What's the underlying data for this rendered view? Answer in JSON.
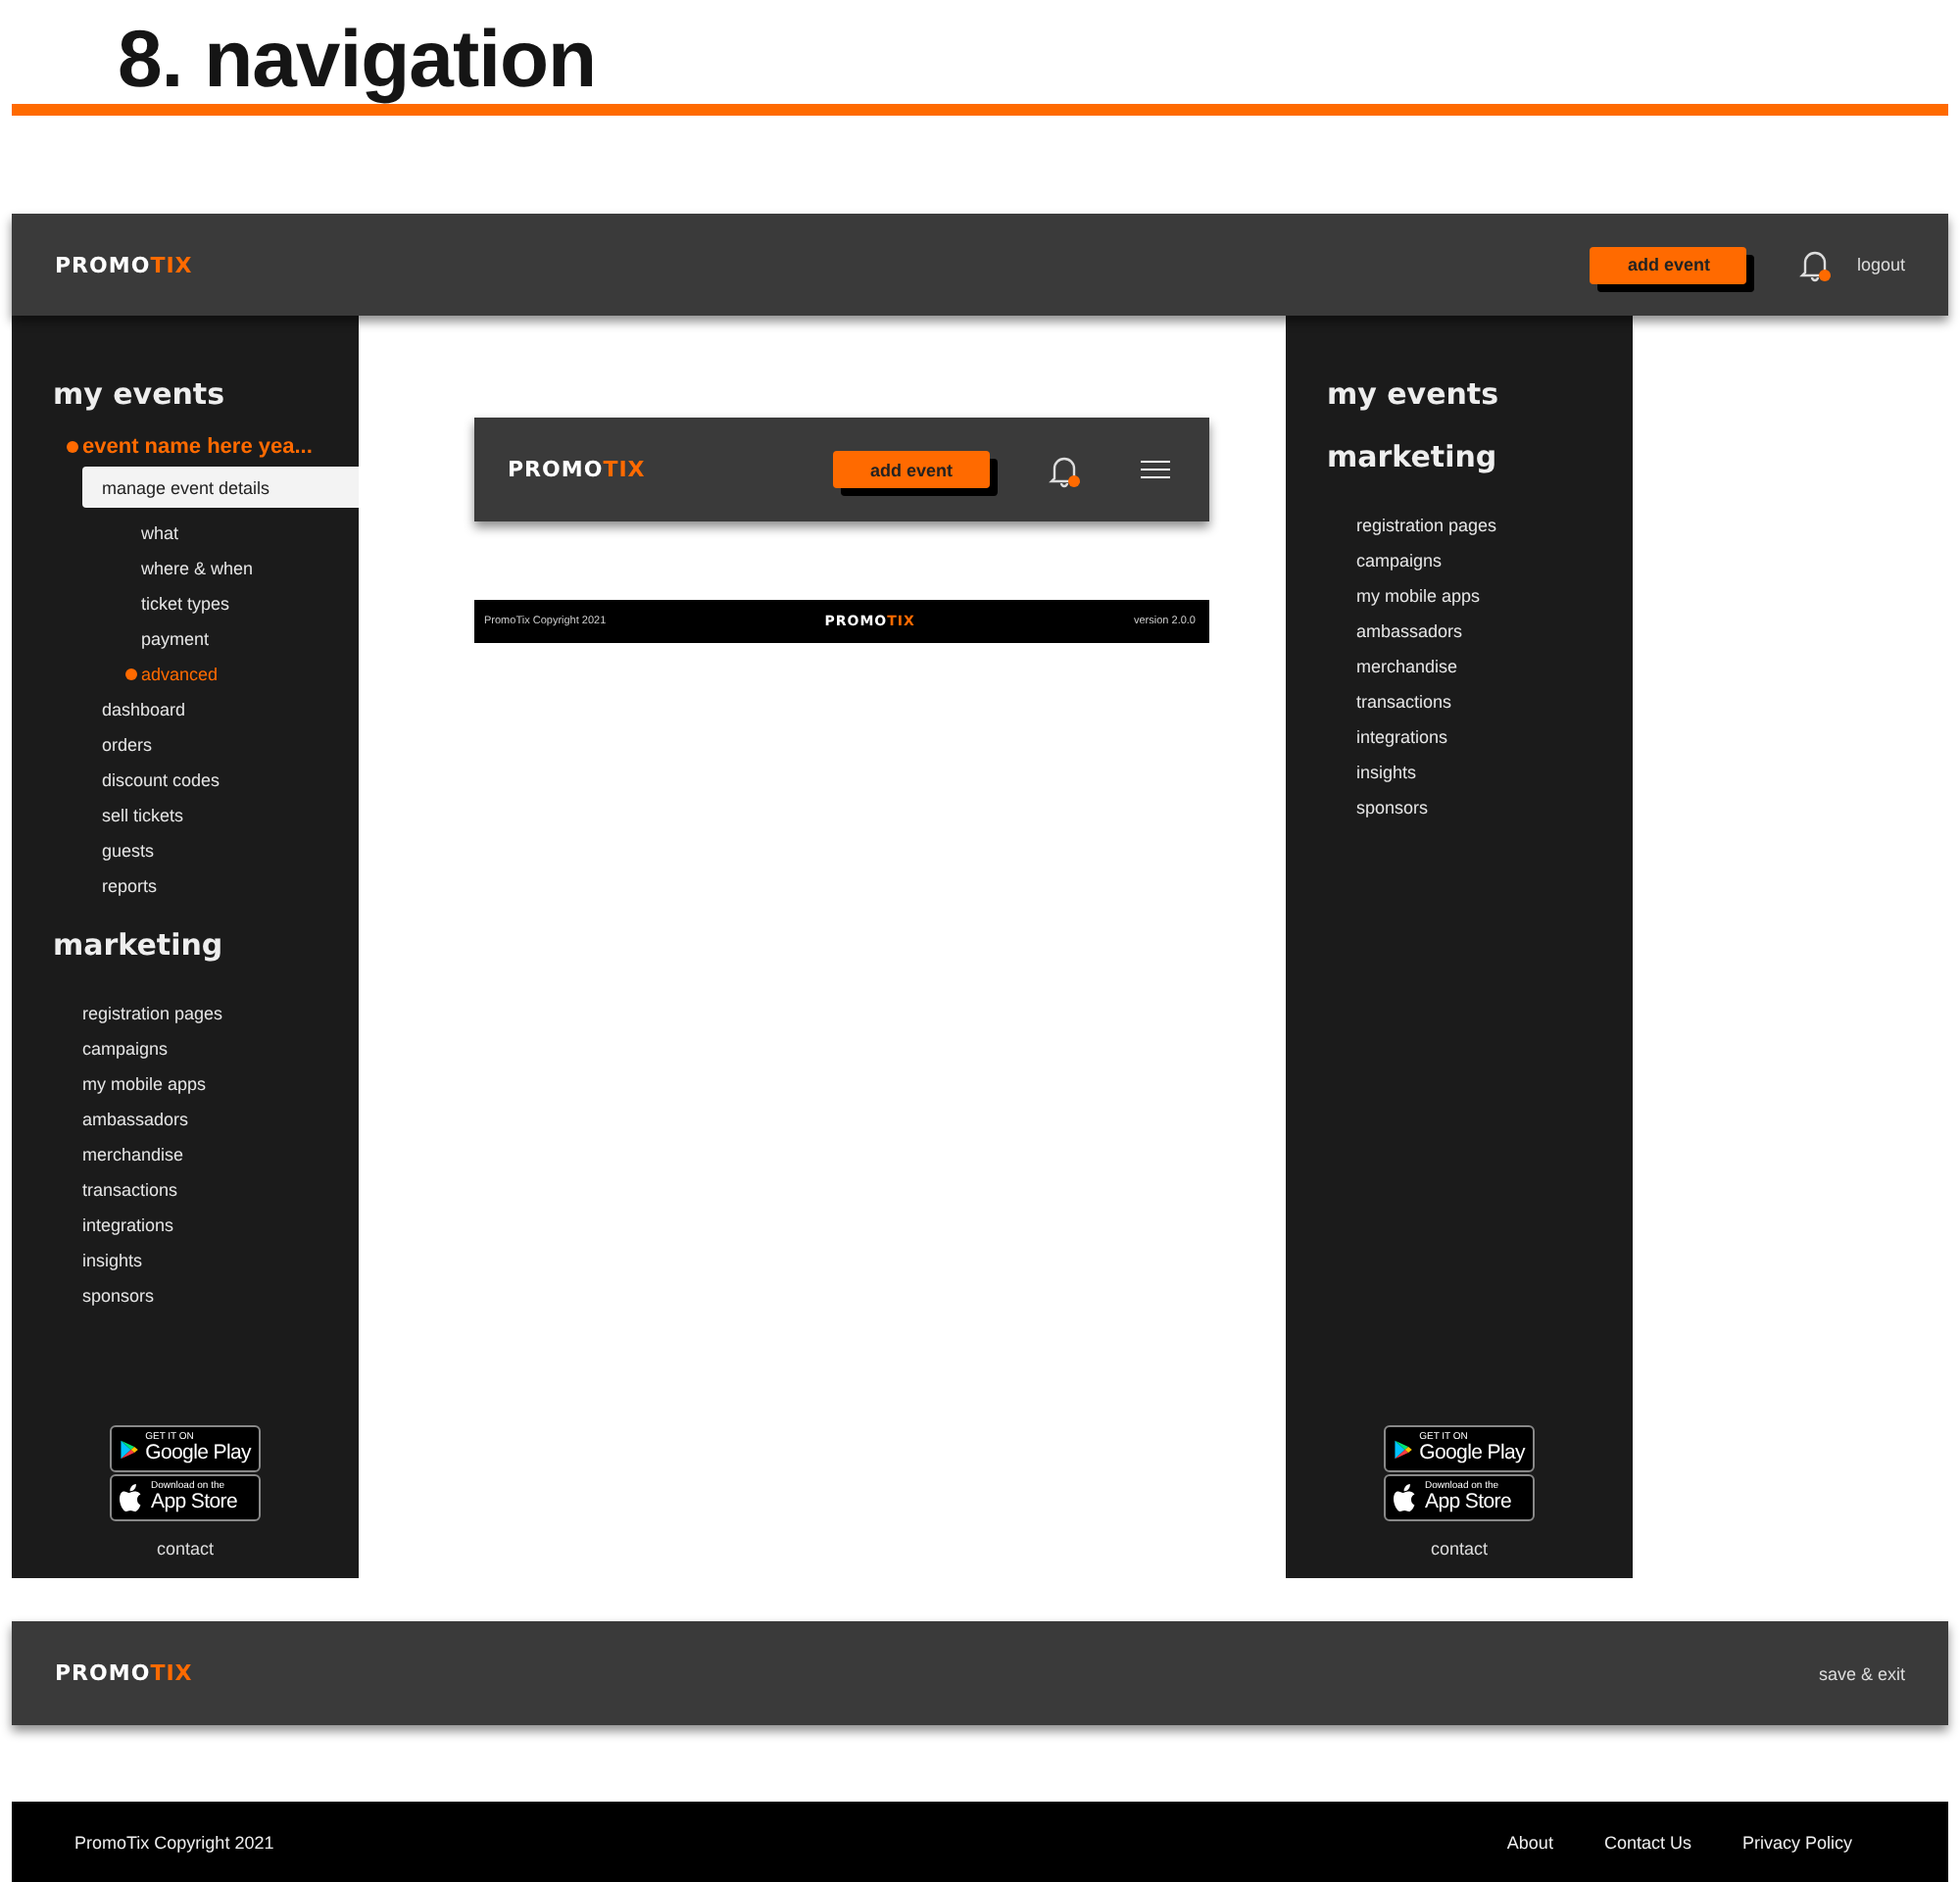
{
  "page_title": "8. navigation",
  "top_bar": {
    "logo": {
      "main": "PROMO",
      "accent": "TIX"
    },
    "add_button": "add event",
    "logout": "logout"
  },
  "left_sidebar": {
    "sections": [
      {
        "title": "my events",
        "items": [
          {
            "label": "event name here yea...",
            "selected": true,
            "children": [
              {
                "label": "manage event details",
                "selected": true,
                "children": [
                  {
                    "label": "what",
                    "selected": false
                  },
                  {
                    "label": "where & when",
                    "selected": false
                  },
                  {
                    "label": "ticket types",
                    "selected": false
                  },
                  {
                    "label": "payment",
                    "selected": false
                  },
                  {
                    "label": "advanced",
                    "selected": true
                  }
                ]
              },
              {
                "label": "dashboard",
                "selected": false
              },
              {
                "label": "orders",
                "selected": false
              },
              {
                "label": "discount codes",
                "selected": false
              },
              {
                "label": "sell tickets",
                "selected": false
              },
              {
                "label": "guests",
                "selected": false
              },
              {
                "label": "reports",
                "selected": false
              }
            ]
          }
        ]
      },
      {
        "title": "marketing",
        "items": [
          {
            "label": "registration pages",
            "selected": false
          },
          {
            "label": "campaigns",
            "selected": false
          },
          {
            "label": "my mobile apps",
            "selected": false
          },
          {
            "label": "ambassadors",
            "selected": false
          },
          {
            "label": "merchandise",
            "selected": false
          },
          {
            "label": "transactions",
            "selected": false
          },
          {
            "label": "integrations",
            "selected": false
          },
          {
            "label": "insights",
            "selected": false
          },
          {
            "label": "sponsors",
            "selected": false
          }
        ]
      }
    ],
    "store_badges": [
      {
        "kind": "google_play",
        "caption": "GET IT ON",
        "store": "Google Play"
      },
      {
        "kind": "app_store",
        "caption": "Download on the",
        "store": "App Store"
      }
    ],
    "contact": "contact"
  },
  "mobile_header": {
    "logo": {
      "main": "PROMO",
      "accent": "TIX"
    },
    "add_button": "add event"
  },
  "mobile_footer": {
    "copyright": "PromoTix Copyright 2021",
    "logo": {
      "main": "PROMO",
      "accent": "TIX"
    },
    "version": "version 2.0.0"
  },
  "right_sidebar": {
    "sections": [
      {
        "title": "my events"
      },
      {
        "title": "marketing",
        "items": [
          {
            "label": "registration pages",
            "selected": false
          },
          {
            "label": "campaigns",
            "selected": false
          },
          {
            "label": "my mobile apps",
            "selected": false
          },
          {
            "label": "ambassadors",
            "selected": false
          },
          {
            "label": "merchandise",
            "selected": false
          },
          {
            "label": "transactions",
            "selected": false
          },
          {
            "label": "integrations",
            "selected": false
          },
          {
            "label": "insights",
            "selected": false
          },
          {
            "label": "sponsors",
            "selected": false
          }
        ]
      }
    ],
    "store_badges": [
      {
        "kind": "google_play",
        "caption": "GET IT ON",
        "store": "Google Play"
      },
      {
        "kind": "app_store",
        "caption": "Download on the",
        "store": "App Store"
      }
    ],
    "contact": "contact"
  },
  "save_bar": {
    "logo": {
      "main": "PROMO",
      "accent": "TIX"
    },
    "save_exit": "save & exit"
  },
  "footer": {
    "copyright": "PromoTix Copyright 2021",
    "links": [
      "About",
      "Contact Us",
      "Privacy Policy"
    ]
  }
}
